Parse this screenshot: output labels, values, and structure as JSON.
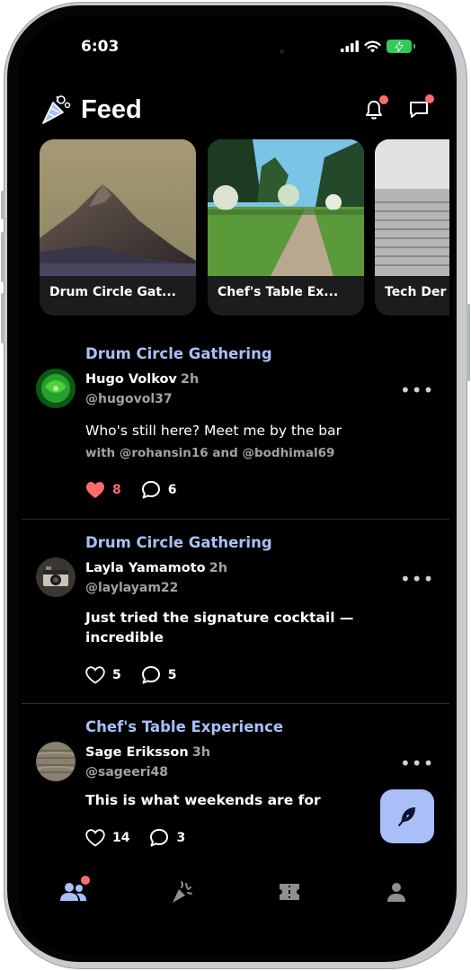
{
  "status_bar": {
    "time": "6:03"
  },
  "header": {
    "title": "Feed"
  },
  "stories": [
    {
      "label": "Drum Circle Gat..."
    },
    {
      "label": "Chef's Table Ex..."
    },
    {
      "label": "Tech Der"
    }
  ],
  "posts": [
    {
      "event": "Drum Circle Gathering",
      "author": "Hugo Volkov",
      "time": "2h",
      "handle": "@hugovol37",
      "text": "Who's still here? Meet me by the bar",
      "with_line": "with @rohansin16 and @bodhimal69",
      "likes": "8",
      "comments": "6",
      "liked": true
    },
    {
      "event": "Drum Circle Gathering",
      "author": "Layla Yamamoto",
      "time": "2h",
      "handle": "@laylayam22",
      "text": "Just tried the signature cocktail — incredible",
      "likes": "5",
      "comments": "5",
      "liked": false
    },
    {
      "event": "Chef's Table Experience",
      "author": "Sage Eriksson",
      "time": "3h",
      "handle": "@sageeri48",
      "text": "This is what weekends are for",
      "likes": "14",
      "comments": "3",
      "liked": false
    }
  ],
  "more_label": "•••",
  "colors": {
    "accent": "#a9bff7",
    "like": "#ff6b6b",
    "notification_dot": "#ff6b6b",
    "battery": "#34c759"
  },
  "icons": {
    "header_logo": "confetti-icon",
    "notifications": "bell-icon",
    "messages": "chat-icon",
    "fab": "feather-icon",
    "nav": [
      "people-icon",
      "party-popper-icon",
      "ticket-icon",
      "person-icon"
    ]
  }
}
